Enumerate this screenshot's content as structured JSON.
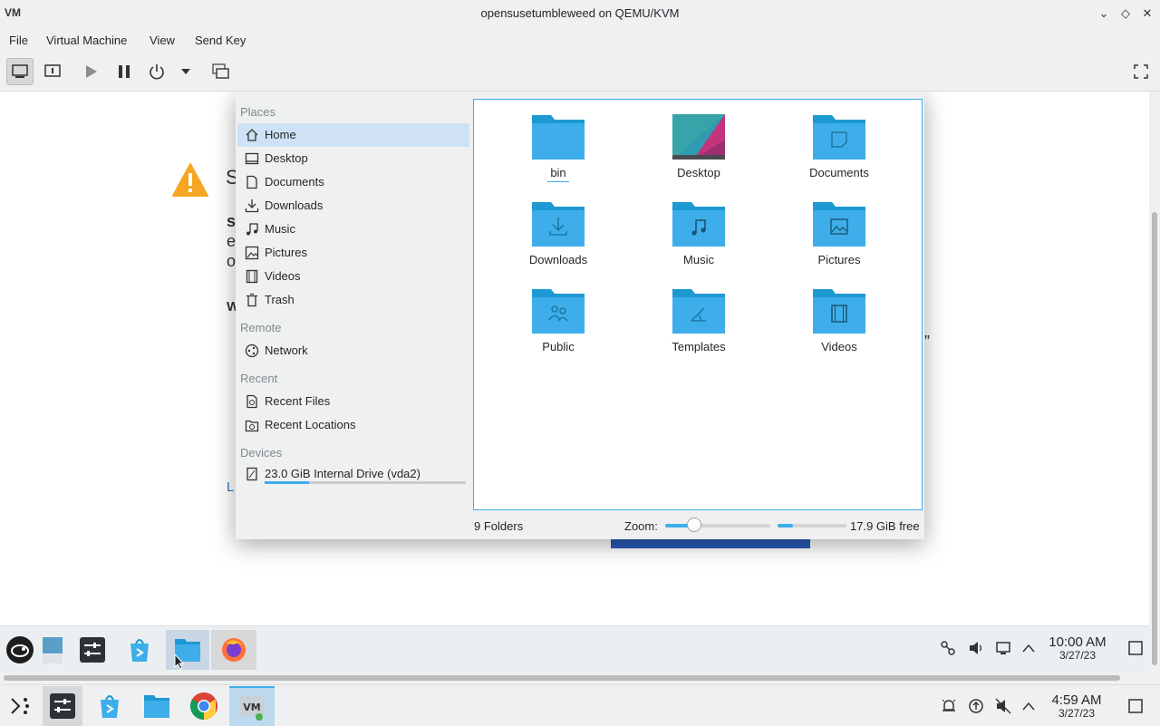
{
  "window": {
    "title": "opensusetumbleweed on QEMU/KVM",
    "logo_text": "VM",
    "controls": {
      "minimize": "⌄",
      "maximize": "◇",
      "close": "✕"
    }
  },
  "menu": {
    "file": "File",
    "virtual_machine": "Virtual Machine",
    "view": "View",
    "send_key": "Send Key"
  },
  "background": {
    "line1": "S",
    "line2": "s",
    "line3": "e",
    "line4": "o",
    "line5": "W",
    "line6": "L",
    "right_quote": "”"
  },
  "dialog": {
    "places": {
      "section_places": "Places",
      "section_remote": "Remote",
      "section_recent": "Recent",
      "section_devices": "Devices",
      "items": [
        {
          "label": "Home",
          "icon": "home-icon"
        },
        {
          "label": "Desktop",
          "icon": "desktop-icon"
        },
        {
          "label": "Documents",
          "icon": "documents-icon"
        },
        {
          "label": "Downloads",
          "icon": "downloads-icon"
        },
        {
          "label": "Music",
          "icon": "music-icon"
        },
        {
          "label": "Pictures",
          "icon": "pictures-icon"
        },
        {
          "label": "Videos",
          "icon": "videos-icon"
        },
        {
          "label": "Trash",
          "icon": "trash-icon"
        }
      ],
      "remote_items": [
        {
          "label": "Network",
          "icon": "network-icon"
        }
      ],
      "recent_items": [
        {
          "label": "Recent Files",
          "icon": "recent-files-icon"
        },
        {
          "label": "Recent Locations",
          "icon": "recent-locations-icon"
        }
      ],
      "device": {
        "label": "23.0 GiB Internal Drive (vda2)",
        "used_fraction": 0.22
      }
    },
    "folders": [
      {
        "label": "bin",
        "icon": "folder-icon"
      },
      {
        "label": "Desktop",
        "icon": "desktop-folder-icon"
      },
      {
        "label": "Documents",
        "icon": "documents-folder-icon"
      },
      {
        "label": "Downloads",
        "icon": "downloads-folder-icon"
      },
      {
        "label": "Music",
        "icon": "music-folder-icon"
      },
      {
        "label": "Pictures",
        "icon": "pictures-folder-icon"
      },
      {
        "label": "Public",
        "icon": "public-folder-icon"
      },
      {
        "label": "Templates",
        "icon": "templates-folder-icon"
      },
      {
        "label": "Videos",
        "icon": "videos-folder-icon"
      }
    ],
    "status": {
      "count": "9 Folders",
      "zoom_label": "Zoom:",
      "zoom_fraction": 0.28,
      "free_text": "17.9 GiB free",
      "free_used_fraction": 0.22
    }
  },
  "guest_panel": {
    "clock_time": "10:00 AM",
    "clock_date": "3/27/23"
  },
  "host_panel": {
    "clock_time": "4:59 AM",
    "clock_date": "3/27/23"
  },
  "colors": {
    "accent": "#3daee9",
    "selection": "#cfe2f5",
    "folder": "#3daee9",
    "folder_dark": "#1d99d3"
  }
}
